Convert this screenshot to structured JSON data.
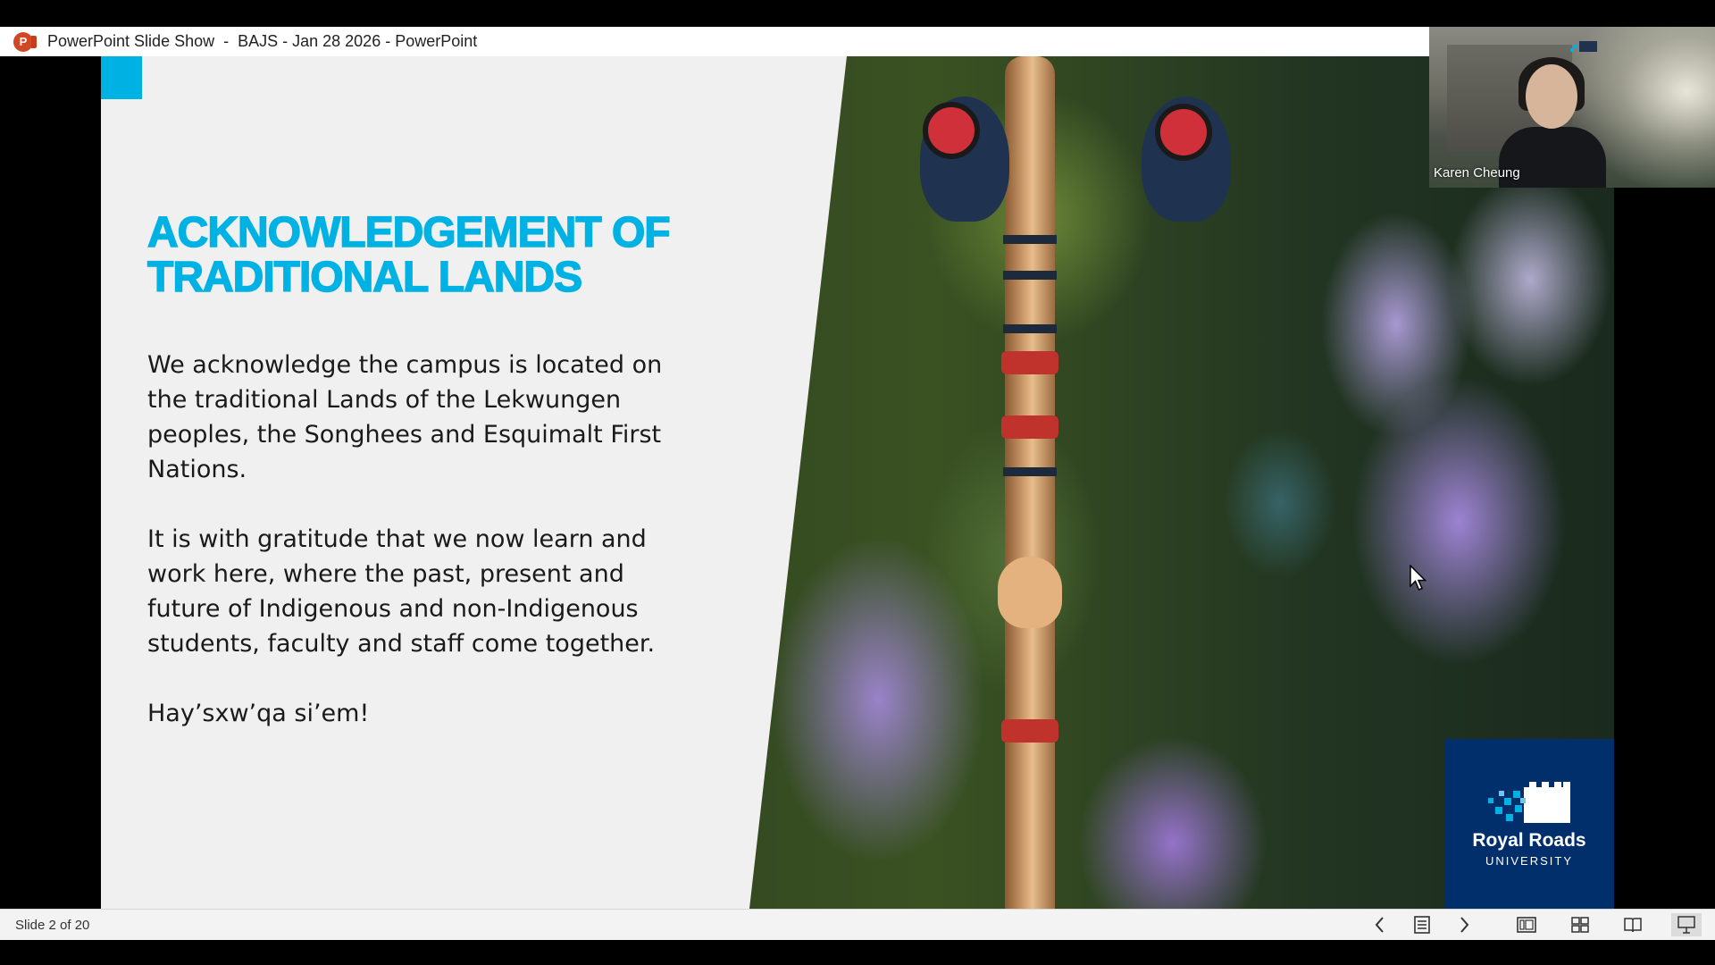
{
  "window": {
    "title": "PowerPoint Slide Show  -  BAJS - Jan 28 2026 - PowerPoint",
    "app_icon": "powerpoint-icon",
    "app_icon_letter": "P"
  },
  "slide": {
    "title_line1": "ACKNOWLEDGEMENT OF",
    "title_line2": "TRADITIONAL LANDS",
    "paragraphs": [
      "We acknowledge the campus is located on the traditional Lands of the Lekwungen peoples, the Songhees and Esquimalt First Nations.",
      "It is with gratitude that we now learn and work here, where the past, present and future of Indigenous and non-Indigenous students, faculty and staff come together.",
      "Hay’sxw’qa si’em!"
    ],
    "logo_name": "Royal Roads",
    "logo_sub": "UNIVERSITY",
    "accent_color": "#00b2e3",
    "logo_bg": "#002f6c"
  },
  "video": {
    "participant_name": "Karen Cheung"
  },
  "statusbar": {
    "slide_counter": "Slide 2 of 20",
    "buttons": [
      {
        "name": "previous-slide-button",
        "icon": "chevron-left-icon"
      },
      {
        "name": "slide-menu-button",
        "icon": "notes-icon"
      },
      {
        "name": "next-slide-button",
        "icon": "chevron-right-icon"
      },
      {
        "name": "normal-view-button",
        "icon": "normal-view-icon"
      },
      {
        "name": "slide-sorter-button",
        "icon": "grid-icon"
      },
      {
        "name": "reading-view-button",
        "icon": "book-icon"
      },
      {
        "name": "slide-show-button",
        "icon": "presenter-icon"
      }
    ]
  }
}
